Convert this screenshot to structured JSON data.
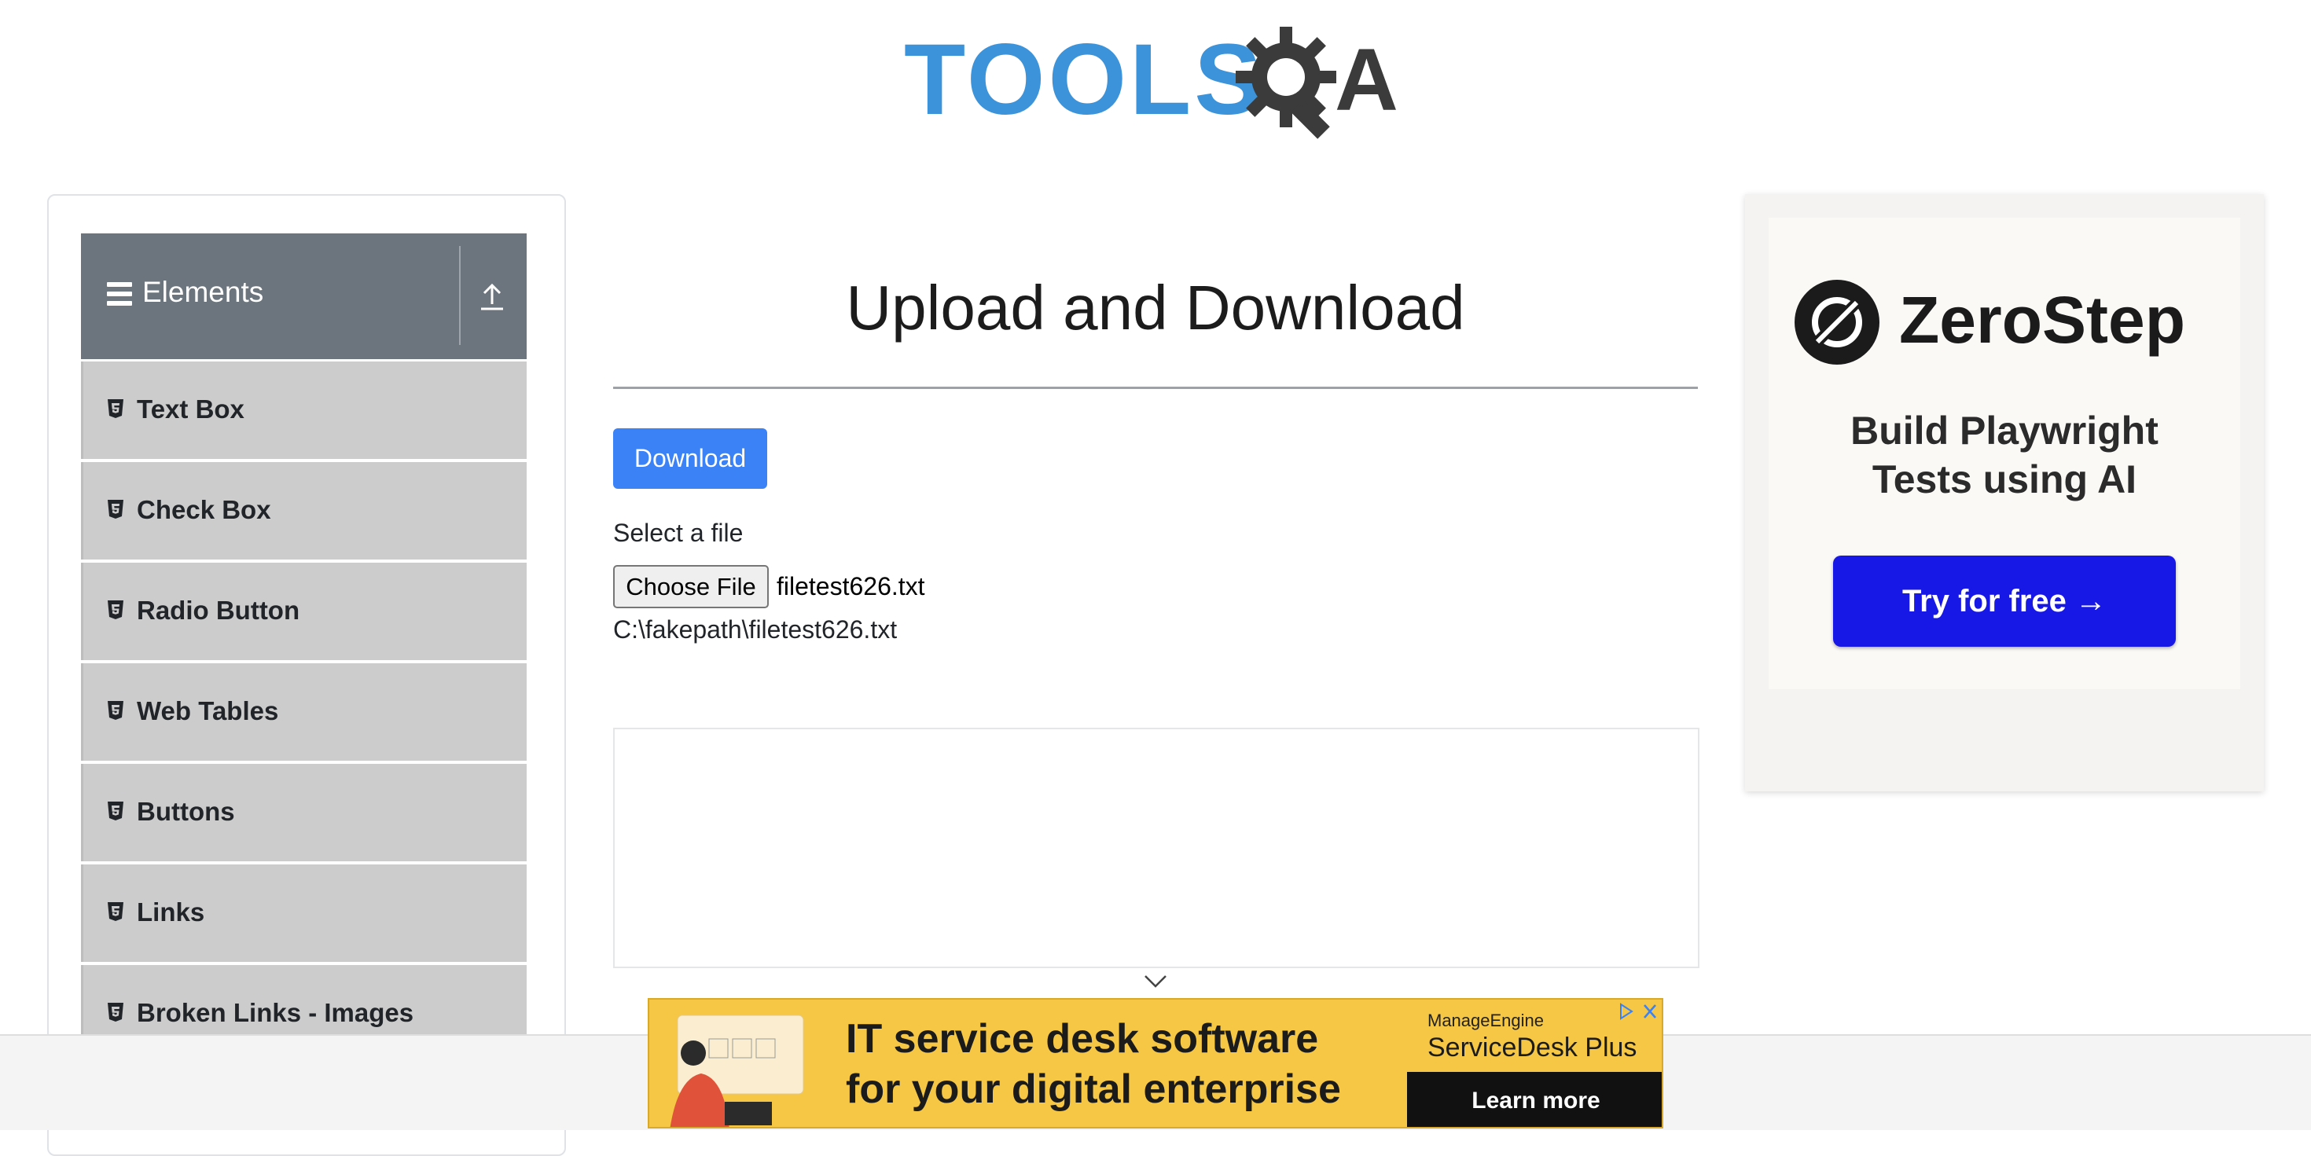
{
  "header": {
    "logo_text": "TOOLS",
    "logo_suffix": "A"
  },
  "sidebar": {
    "group_title": "Elements",
    "items": [
      {
        "label": "Text Box"
      },
      {
        "label": "Check Box"
      },
      {
        "label": "Radio Button"
      },
      {
        "label": "Web Tables"
      },
      {
        "label": "Buttons"
      },
      {
        "label": "Links"
      },
      {
        "label": "Broken Links - Images"
      }
    ]
  },
  "main": {
    "title": "Upload and Download",
    "download_label": "Download",
    "select_label": "Select a file",
    "choose_file_label": "Choose File",
    "chosen_file_name": "filetest626.txt",
    "uploaded_path": "C:\\fakepath\\filetest626.txt"
  },
  "right_ad": {
    "brand": "ZeroStep",
    "tagline_line1": "Build Playwright",
    "tagline_line2": "Tests using AI",
    "cta": "Try for free →"
  },
  "bottom_banner": {
    "headline_line1": "IT service desk software",
    "headline_line2": "for your digital enterprise",
    "brand": "ManageEngine",
    "product": "ServiceDesk Plus",
    "cta": "Learn more"
  },
  "colors": {
    "logo_blue": "#3d93d9",
    "sidebar_header": "#6c757d",
    "menu_item_bg": "#cccccc",
    "primary_button": "#3b82f6",
    "ad_cta": "#1818e6",
    "banner_bg": "#f5c744"
  }
}
